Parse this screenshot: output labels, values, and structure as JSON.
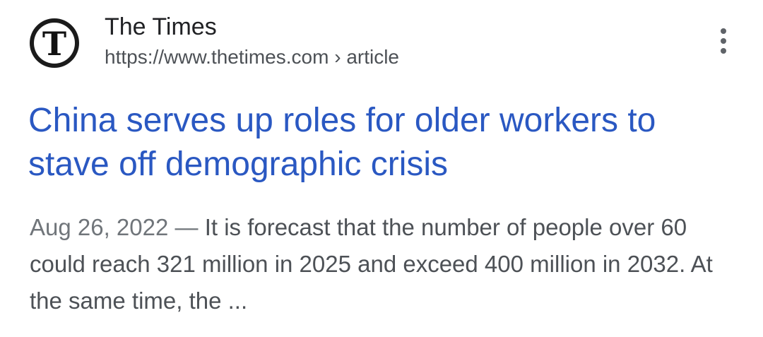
{
  "site": {
    "name": "The Times",
    "url": "https://www.thetimes.com › article",
    "favicon_letter": "T",
    "favicon_icon": "the-times-logo-icon"
  },
  "menu": {
    "icon": "more-vert-icon"
  },
  "result": {
    "title": "China serves up roles for older workers to stave off demographic crisis",
    "date": "Aug 26, 2022 — ",
    "snippet": "It is forecast that the number of people over 60 could reach 321 million in 2025 and exceed 400 million in 2032. At the same time, the ..."
  },
  "colors": {
    "title_link": "#2a58c2",
    "snippet_text": "#4d5156",
    "site_name": "#202124",
    "menu_dots": "#5f6368"
  }
}
